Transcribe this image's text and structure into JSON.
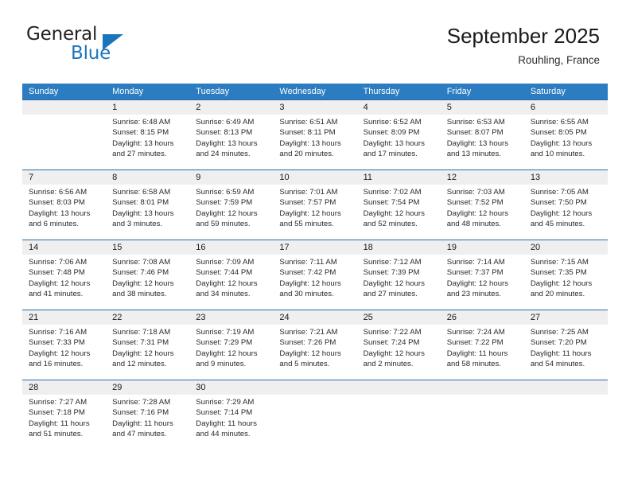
{
  "brand": {
    "name_part1": "General",
    "name_part2": "Blue",
    "triangle_color": "#1b75bb"
  },
  "header": {
    "title": "September 2025",
    "subtitle": "Rouhling, France"
  },
  "calendar": {
    "header_bg": "#2b7cc0",
    "daynum_bg": "#efefef",
    "weekdays": [
      "Sunday",
      "Monday",
      "Tuesday",
      "Wednesday",
      "Thursday",
      "Friday",
      "Saturday"
    ],
    "weeks": [
      [
        {
          "day": "",
          "sunrise": "",
          "sunset": "",
          "daylight": "",
          "daylight2": ""
        },
        {
          "day": "1",
          "sunrise": "Sunrise: 6:48 AM",
          "sunset": "Sunset: 8:15 PM",
          "daylight": "Daylight: 13 hours",
          "daylight2": "and 27 minutes."
        },
        {
          "day": "2",
          "sunrise": "Sunrise: 6:49 AM",
          "sunset": "Sunset: 8:13 PM",
          "daylight": "Daylight: 13 hours",
          "daylight2": "and 24 minutes."
        },
        {
          "day": "3",
          "sunrise": "Sunrise: 6:51 AM",
          "sunset": "Sunset: 8:11 PM",
          "daylight": "Daylight: 13 hours",
          "daylight2": "and 20 minutes."
        },
        {
          "day": "4",
          "sunrise": "Sunrise: 6:52 AM",
          "sunset": "Sunset: 8:09 PM",
          "daylight": "Daylight: 13 hours",
          "daylight2": "and 17 minutes."
        },
        {
          "day": "5",
          "sunrise": "Sunrise: 6:53 AM",
          "sunset": "Sunset: 8:07 PM",
          "daylight": "Daylight: 13 hours",
          "daylight2": "and 13 minutes."
        },
        {
          "day": "6",
          "sunrise": "Sunrise: 6:55 AM",
          "sunset": "Sunset: 8:05 PM",
          "daylight": "Daylight: 13 hours",
          "daylight2": "and 10 minutes."
        }
      ],
      [
        {
          "day": "7",
          "sunrise": "Sunrise: 6:56 AM",
          "sunset": "Sunset: 8:03 PM",
          "daylight": "Daylight: 13 hours",
          "daylight2": "and 6 minutes."
        },
        {
          "day": "8",
          "sunrise": "Sunrise: 6:58 AM",
          "sunset": "Sunset: 8:01 PM",
          "daylight": "Daylight: 13 hours",
          "daylight2": "and 3 minutes."
        },
        {
          "day": "9",
          "sunrise": "Sunrise: 6:59 AM",
          "sunset": "Sunset: 7:59 PM",
          "daylight": "Daylight: 12 hours",
          "daylight2": "and 59 minutes."
        },
        {
          "day": "10",
          "sunrise": "Sunrise: 7:01 AM",
          "sunset": "Sunset: 7:57 PM",
          "daylight": "Daylight: 12 hours",
          "daylight2": "and 55 minutes."
        },
        {
          "day": "11",
          "sunrise": "Sunrise: 7:02 AM",
          "sunset": "Sunset: 7:54 PM",
          "daylight": "Daylight: 12 hours",
          "daylight2": "and 52 minutes."
        },
        {
          "day": "12",
          "sunrise": "Sunrise: 7:03 AM",
          "sunset": "Sunset: 7:52 PM",
          "daylight": "Daylight: 12 hours",
          "daylight2": "and 48 minutes."
        },
        {
          "day": "13",
          "sunrise": "Sunrise: 7:05 AM",
          "sunset": "Sunset: 7:50 PM",
          "daylight": "Daylight: 12 hours",
          "daylight2": "and 45 minutes."
        }
      ],
      [
        {
          "day": "14",
          "sunrise": "Sunrise: 7:06 AM",
          "sunset": "Sunset: 7:48 PM",
          "daylight": "Daylight: 12 hours",
          "daylight2": "and 41 minutes."
        },
        {
          "day": "15",
          "sunrise": "Sunrise: 7:08 AM",
          "sunset": "Sunset: 7:46 PM",
          "daylight": "Daylight: 12 hours",
          "daylight2": "and 38 minutes."
        },
        {
          "day": "16",
          "sunrise": "Sunrise: 7:09 AM",
          "sunset": "Sunset: 7:44 PM",
          "daylight": "Daylight: 12 hours",
          "daylight2": "and 34 minutes."
        },
        {
          "day": "17",
          "sunrise": "Sunrise: 7:11 AM",
          "sunset": "Sunset: 7:42 PM",
          "daylight": "Daylight: 12 hours",
          "daylight2": "and 30 minutes."
        },
        {
          "day": "18",
          "sunrise": "Sunrise: 7:12 AM",
          "sunset": "Sunset: 7:39 PM",
          "daylight": "Daylight: 12 hours",
          "daylight2": "and 27 minutes."
        },
        {
          "day": "19",
          "sunrise": "Sunrise: 7:14 AM",
          "sunset": "Sunset: 7:37 PM",
          "daylight": "Daylight: 12 hours",
          "daylight2": "and 23 minutes."
        },
        {
          "day": "20",
          "sunrise": "Sunrise: 7:15 AM",
          "sunset": "Sunset: 7:35 PM",
          "daylight": "Daylight: 12 hours",
          "daylight2": "and 20 minutes."
        }
      ],
      [
        {
          "day": "21",
          "sunrise": "Sunrise: 7:16 AM",
          "sunset": "Sunset: 7:33 PM",
          "daylight": "Daylight: 12 hours",
          "daylight2": "and 16 minutes."
        },
        {
          "day": "22",
          "sunrise": "Sunrise: 7:18 AM",
          "sunset": "Sunset: 7:31 PM",
          "daylight": "Daylight: 12 hours",
          "daylight2": "and 12 minutes."
        },
        {
          "day": "23",
          "sunrise": "Sunrise: 7:19 AM",
          "sunset": "Sunset: 7:29 PM",
          "daylight": "Daylight: 12 hours",
          "daylight2": "and 9 minutes."
        },
        {
          "day": "24",
          "sunrise": "Sunrise: 7:21 AM",
          "sunset": "Sunset: 7:26 PM",
          "daylight": "Daylight: 12 hours",
          "daylight2": "and 5 minutes."
        },
        {
          "day": "25",
          "sunrise": "Sunrise: 7:22 AM",
          "sunset": "Sunset: 7:24 PM",
          "daylight": "Daylight: 12 hours",
          "daylight2": "and 2 minutes."
        },
        {
          "day": "26",
          "sunrise": "Sunrise: 7:24 AM",
          "sunset": "Sunset: 7:22 PM",
          "daylight": "Daylight: 11 hours",
          "daylight2": "and 58 minutes."
        },
        {
          "day": "27",
          "sunrise": "Sunrise: 7:25 AM",
          "sunset": "Sunset: 7:20 PM",
          "daylight": "Daylight: 11 hours",
          "daylight2": "and 54 minutes."
        }
      ],
      [
        {
          "day": "28",
          "sunrise": "Sunrise: 7:27 AM",
          "sunset": "Sunset: 7:18 PM",
          "daylight": "Daylight: 11 hours",
          "daylight2": "and 51 minutes."
        },
        {
          "day": "29",
          "sunrise": "Sunrise: 7:28 AM",
          "sunset": "Sunset: 7:16 PM",
          "daylight": "Daylight: 11 hours",
          "daylight2": "and 47 minutes."
        },
        {
          "day": "30",
          "sunrise": "Sunrise: 7:29 AM",
          "sunset": "Sunset: 7:14 PM",
          "daylight": "Daylight: 11 hours",
          "daylight2": "and 44 minutes."
        },
        {
          "day": "",
          "sunrise": "",
          "sunset": "",
          "daylight": "",
          "daylight2": ""
        },
        {
          "day": "",
          "sunrise": "",
          "sunset": "",
          "daylight": "",
          "daylight2": ""
        },
        {
          "day": "",
          "sunrise": "",
          "sunset": "",
          "daylight": "",
          "daylight2": ""
        },
        {
          "day": "",
          "sunrise": "",
          "sunset": "",
          "daylight": "",
          "daylight2": ""
        }
      ]
    ]
  }
}
